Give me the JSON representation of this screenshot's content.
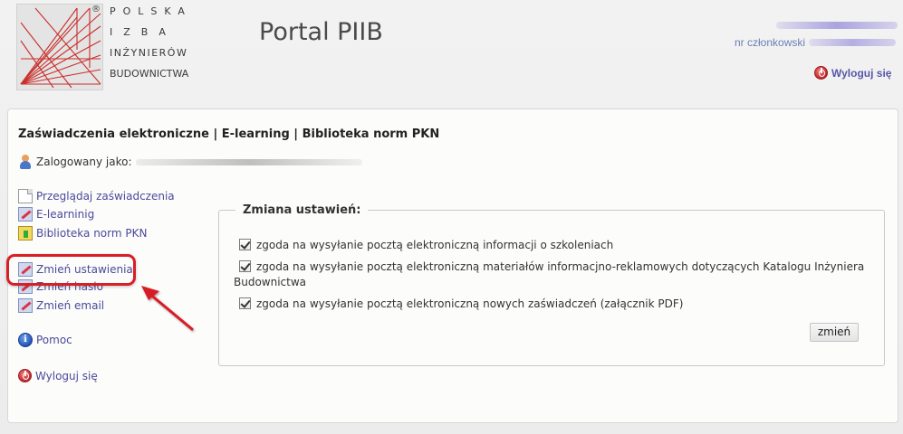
{
  "header": {
    "logo_registered": "®",
    "logo_lines": [
      "POLSKA",
      "IZBA",
      "INŻYNIERÓW",
      "BUDOWNICTWA"
    ],
    "portal_title": "Portal PIIB",
    "member_label": "nr członkowski",
    "logout_label": "Wyloguj się"
  },
  "nav": {
    "item1": "Zaświadczenia elektroniczne",
    "sep1": " | ",
    "item2": "E-learning",
    "sep2": " | ",
    "item3": "Biblioteka norm PKN"
  },
  "logged_as_label": "Zalogowany jako:",
  "sidebar": {
    "items": [
      {
        "label": "Przeglądaj zaświadczenia",
        "icon": "document-icon"
      },
      {
        "label": "E-learninig",
        "icon": "edit-icon"
      },
      {
        "label": "Biblioteka norm PKN",
        "icon": "book-icon"
      },
      {
        "label": "Zmień ustawienia",
        "icon": "edit-icon"
      },
      {
        "label": "Zmień hasło",
        "icon": "edit-icon"
      },
      {
        "label": "Zmień email",
        "icon": "edit-icon"
      },
      {
        "label": "Pomoc",
        "icon": "info-icon"
      },
      {
        "label": "Wyloguj się",
        "icon": "power-icon"
      }
    ]
  },
  "settings": {
    "legend": "Zmiana ustawień:",
    "options": [
      {
        "label": "zgoda na wysyłanie pocztą elektroniczną informacji o szkoleniach",
        "checked": true
      },
      {
        "label": "zgoda na wysyłanie pocztą elektroniczną materiałów informacjno-reklamowych dotyczących Katalogu Inżyniera Budownictwa",
        "checked": true
      },
      {
        "label": "zgoda na wysyłanie pocztą elektroniczną nowych zaświadczeń (załącznik PDF)",
        "checked": true
      }
    ],
    "submit_label": "zmień"
  },
  "colors": {
    "link": "#4a4a9a",
    "highlight": "#d81f26",
    "logout": "#5a57a8"
  }
}
